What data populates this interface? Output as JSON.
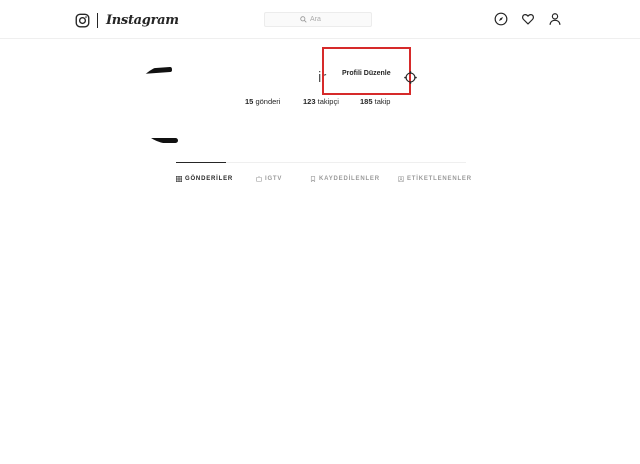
{
  "header": {
    "brand": "Instagram",
    "search_placeholder": "Ara",
    "icons": [
      "instagram-glyph-icon",
      "search-icon",
      "compass-icon",
      "heart-icon",
      "user-icon"
    ]
  },
  "profile": {
    "username_fragment": "ir",
    "edit_button": "Profili Düzenle",
    "settings_icon": "gear-icon",
    "stats": [
      {
        "count": "15",
        "label": "gönderi"
      },
      {
        "count": "123",
        "label": "takipçi"
      },
      {
        "count": "185",
        "label": "takip"
      }
    ]
  },
  "tabs": [
    {
      "label": "GÖNDERİLER",
      "icon": "grid-icon",
      "active": true
    },
    {
      "label": "IGTV",
      "icon": "tv-icon",
      "active": false
    },
    {
      "label": "KAYDEDİLENLER",
      "icon": "bookmark-icon",
      "active": false
    },
    {
      "label": "ETİKETLENENLER",
      "icon": "tag-icon",
      "active": false
    }
  ],
  "colors": {
    "highlight_border": "#d62a2a",
    "text": "#262626",
    "muted": "#9a9a9a"
  }
}
